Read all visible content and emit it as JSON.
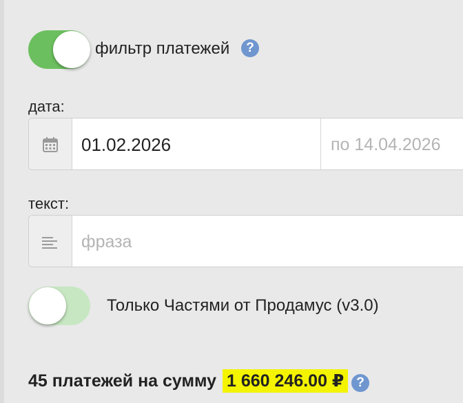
{
  "filter": {
    "toggle_on": true,
    "label": "фильтр платежей",
    "help": "?"
  },
  "date": {
    "label": "дата:",
    "from_value": "01.02.2026",
    "to_placeholder": "по 14.04.2026",
    "icon": "calendar-icon"
  },
  "text": {
    "label": "текст:",
    "placeholder": "фраза",
    "icon": "lines-icon"
  },
  "installments": {
    "toggle_on": false,
    "label": "Только Частями от Продамус (v3.0)"
  },
  "summary": {
    "prefix": "45 платежей на сумму",
    "amount": "1 660 246.00 ₽",
    "help": "?"
  },
  "colors": {
    "toggle_on": "#6cbf5f",
    "toggle_off": "#c7e7c2",
    "help_badge": "#6f96cf",
    "highlight": "#f4f400"
  }
}
